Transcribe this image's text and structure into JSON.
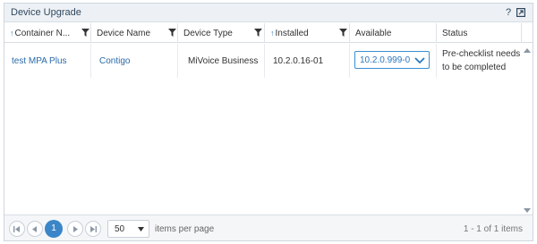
{
  "panel": {
    "title": "Device Upgrade",
    "help_label": "?",
    "popout_icon": "popout-icon"
  },
  "columns": [
    {
      "label": "Container N...",
      "sorted": "asc",
      "filter": true
    },
    {
      "label": "Device Name",
      "sorted": null,
      "filter": true
    },
    {
      "label": "Device Type",
      "sorted": null,
      "filter": true
    },
    {
      "label": "Installed",
      "sorted": "asc",
      "filter": true
    },
    {
      "label": "Available",
      "sorted": null,
      "filter": false
    },
    {
      "label": "Status",
      "sorted": null,
      "filter": false
    }
  ],
  "sort_icon": "↑",
  "rows": [
    {
      "container": "test MPA Plus",
      "device_name": "Contigo",
      "device_type": "MiVoice Business",
      "installed": "10.2.0.16-01",
      "available": "10.2.0.999-0",
      "status_line1": "Pre-checklist needs",
      "status_line2": "to be completed"
    }
  ],
  "pager": {
    "current_page": "1",
    "page_size": "50",
    "items_label": "items per page",
    "range_label": "1 - 1 of 1 items"
  },
  "colors": {
    "accent": "#3b86c8",
    "link": "#2a6aa8",
    "header_bg": "#edf1f5"
  }
}
